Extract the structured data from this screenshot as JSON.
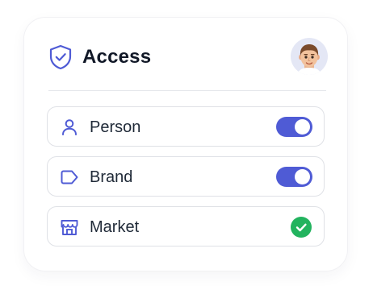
{
  "header": {
    "title": "Access",
    "title_icon": "shield-check-icon",
    "avatar": "user-avatar"
  },
  "permissions": [
    {
      "label": "Person",
      "icon": "person-icon",
      "control": "toggle",
      "enabled": true
    },
    {
      "label": "Brand",
      "icon": "tag-icon",
      "control": "toggle",
      "enabled": true
    },
    {
      "label": "Market",
      "icon": "store-icon",
      "control": "check",
      "enabled": true
    }
  ],
  "colors": {
    "accent": "#4f5bd5",
    "success": "#22b35e",
    "text": "#111827",
    "border": "#dfe1e6"
  }
}
